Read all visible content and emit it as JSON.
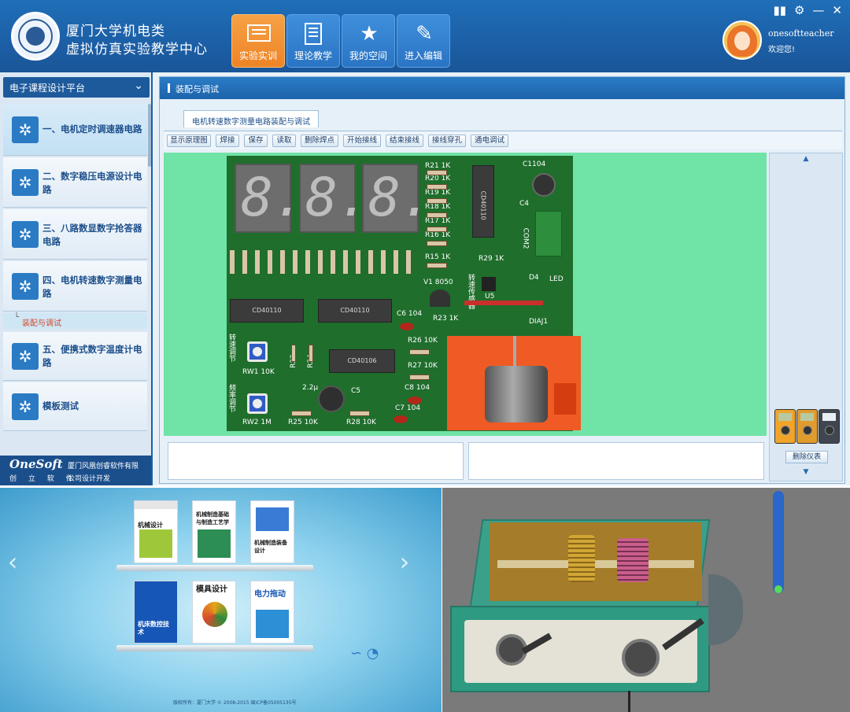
{
  "header": {
    "title_line1": "厦门大学机电类",
    "title_line2": "虚拟仿真实验教学中心",
    "nav": [
      {
        "label": "实验实训",
        "icon": "monitor-icon",
        "active": true
      },
      {
        "label": "理论教学",
        "icon": "document-icon",
        "active": false
      },
      {
        "label": "我的空间",
        "icon": "star-icon",
        "active": false
      },
      {
        "label": "进入编辑",
        "icon": "edit-icon",
        "active": false
      }
    ],
    "user_name": "onesoftteacher",
    "user_greeting": "欢迎您!"
  },
  "sidebar": {
    "platform": "电子课程设计平台",
    "items": [
      {
        "label": "一、电机定时调速器电路"
      },
      {
        "label": "二、数字稳压电源设计电路"
      },
      {
        "label": "三、八路数显数字抢答器电路"
      },
      {
        "label": "四、电机转速数字测量电路"
      },
      {
        "label": "五、便携式数字温度计电路"
      },
      {
        "label": "模板测试"
      }
    ],
    "sub_item": "装配与调试",
    "footer_logo": "OneSoft",
    "footer_logo_cn": "创 立 软 件",
    "footer_company1": "厦门风凰创睿软件有限",
    "footer_company2": "公司设计开发"
  },
  "main": {
    "title": "装配与调试",
    "tab": "电机转速数字测量电路装配与调试",
    "toolbar": [
      "显示原理图",
      "焊接",
      "保存",
      "读取",
      "删除焊点",
      "开始接线",
      "结束接线",
      "接线穿孔",
      "通电调试"
    ],
    "delete_meter": "删除仪表"
  },
  "pcb": {
    "digits": [
      "8.",
      "8.",
      "8."
    ],
    "resistors_right": [
      "R21 1K",
      "R20 1K",
      "R19 1K",
      "R18 1K",
      "R17 1K",
      "R16 1K",
      "R15 1K"
    ],
    "r29": "R29 1K",
    "c1104": "C1104",
    "c4": "C4",
    "com2": "COM2",
    "v1": "V1 8050",
    "u5": "U5",
    "d4": "D4",
    "led": "LED",
    "chip_left": "CD40110",
    "chip_mid": "CD40110",
    "chip_vertical": "CD40110",
    "chip_lower": "CD40106",
    "c6_104": "C6 104",
    "r23": "R23 1K",
    "r26": "R26 10K",
    "r27": "R27 10K",
    "c8": "C8 104",
    "c7": "C7 104",
    "c5": "C5",
    "c5_val": "2.2μ",
    "rw1": "RW1 10K",
    "rw2": "RW2 1M",
    "r22": "R22",
    "r24": "R24",
    "r25": "R25 10K",
    "r28": "R28 10K",
    "speed_adj": "转速调节",
    "freq_adj": "频率调节",
    "sensor": "转速传感器",
    "diaj1": "DIAJ1"
  },
  "books": [
    {
      "title": "机械设计",
      "color": "#9ec83a"
    },
    {
      "title": "机械制造基础与制造工艺学",
      "color": "#2c8e55"
    },
    {
      "title": "机械制造装备设计",
      "color": "#3a7bd5"
    },
    {
      "title": "机床数控技术",
      "color": "#1656b6"
    },
    {
      "title": "模具设计",
      "color": "#e4a31b"
    },
    {
      "title": "电力拖动",
      "color": "#2d8fd6"
    }
  ],
  "shelf_footer": "版权所有：厦门大学 © 2008-2015 闽ICP备05005135号"
}
